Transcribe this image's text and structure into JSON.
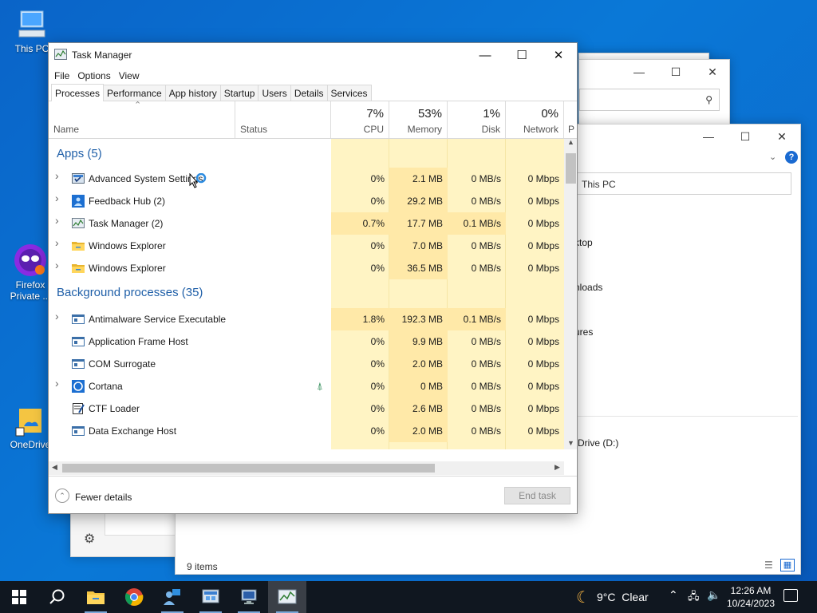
{
  "desktop": {
    "icons": [
      {
        "label": "This PC"
      },
      {
        "label": "Firefox Private ..."
      },
      {
        "label": "OneDrive"
      }
    ]
  },
  "explorer": {
    "address": "This PC",
    "nav_items": [
      "ktop",
      "nloads",
      "ures",
      "Drive (D:)"
    ],
    "status": "9 items"
  },
  "task_manager": {
    "title": "Task Manager",
    "menu": [
      "File",
      "Options",
      "View"
    ],
    "tabs": [
      "Processes",
      "Performance",
      "App history",
      "Startup",
      "Users",
      "Details",
      "Services"
    ],
    "active_tab": "Processes",
    "columns": {
      "name": "Name",
      "status": "Status",
      "cpu": {
        "pct": "7%",
        "label": "CPU"
      },
      "memory": {
        "pct": "53%",
        "label": "Memory"
      },
      "disk": {
        "pct": "1%",
        "label": "Disk"
      },
      "network": {
        "pct": "0%",
        "label": "Network"
      },
      "power": "P"
    },
    "groups": [
      {
        "title": "Apps (5)",
        "rows": [
          {
            "name": "Advanced System Settings",
            "icon": "system-settings-icon",
            "expandable": true,
            "cpu": "0%",
            "memory": "2.1 MB",
            "disk": "0 MB/s",
            "network": "0 Mbps"
          },
          {
            "name": "Feedback Hub (2)",
            "icon": "feedback-hub-icon",
            "expandable": true,
            "cpu": "0%",
            "memory": "29.2 MB",
            "disk": "0 MB/s",
            "network": "0 Mbps"
          },
          {
            "name": "Task Manager (2)",
            "icon": "task-manager-icon",
            "expandable": true,
            "cpu": "0.7%",
            "memory": "17.7 MB",
            "disk": "0.1 MB/s",
            "network": "0 Mbps"
          },
          {
            "name": "Windows Explorer",
            "icon": "folder-icon",
            "expandable": true,
            "cpu": "0%",
            "memory": "7.0 MB",
            "disk": "0 MB/s",
            "network": "0 Mbps"
          },
          {
            "name": "Windows Explorer",
            "icon": "folder-icon",
            "expandable": true,
            "cpu": "0%",
            "memory": "36.5 MB",
            "disk": "0 MB/s",
            "network": "0 Mbps"
          }
        ]
      },
      {
        "title": "Background processes (35)",
        "rows": [
          {
            "name": "Antimalware Service Executable",
            "icon": "app-window-icon",
            "expandable": true,
            "cpu": "1.8%",
            "memory": "192.3 MB",
            "disk": "0.1 MB/s",
            "network": "0 Mbps"
          },
          {
            "name": "Application Frame Host",
            "icon": "app-window-icon",
            "expandable": false,
            "cpu": "0%",
            "memory": "9.9 MB",
            "disk": "0 MB/s",
            "network": "0 Mbps"
          },
          {
            "name": "COM Surrogate",
            "icon": "app-window-icon",
            "expandable": false,
            "cpu": "0%",
            "memory": "2.0 MB",
            "disk": "0 MB/s",
            "network": "0 Mbps"
          },
          {
            "name": "Cortana",
            "icon": "cortana-icon",
            "expandable": true,
            "status_leaf": true,
            "cpu": "0%",
            "memory": "0 MB",
            "disk": "0 MB/s",
            "network": "0 Mbps"
          },
          {
            "name": "CTF Loader",
            "icon": "ctf-loader-icon",
            "expandable": false,
            "cpu": "0%",
            "memory": "2.6 MB",
            "disk": "0 MB/s",
            "network": "0 Mbps"
          },
          {
            "name": "Data Exchange Host",
            "icon": "app-window-icon",
            "expandable": false,
            "cpu": "0%",
            "memory": "2.0 MB",
            "disk": "0 MB/s",
            "network": "0 Mbps"
          }
        ]
      }
    ],
    "footer": {
      "fewer_details": "Fewer details",
      "end_task": "End task"
    }
  },
  "taskbar": {
    "weather": "9°C  Clear",
    "time": "12:26 AM",
    "date": "10/24/2023"
  },
  "colors": {
    "heat_light": "#fff4c4",
    "heat_mid": "#ffe9a8",
    "group_title": "#1f5fa8",
    "taskbar": "#101720"
  }
}
